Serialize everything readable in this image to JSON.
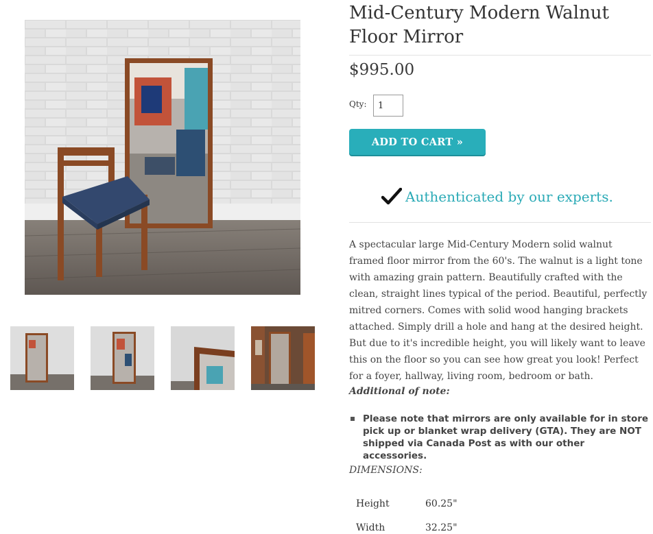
{
  "product": {
    "title": "Mid-Century Modern Walnut Floor Mirror",
    "price": "$995.00",
    "qty_label": "Qty:",
    "qty_value": "1",
    "add_to_cart": "ADD TO CART »",
    "authenticated": "Authenticated by our experts."
  },
  "description": "A spectacular large Mid-Century Modern solid walnut framed floor mirror from the 60's. The walnut is a light tone with amazing grain pattern. Beautifully crafted with the clean, straight lines typical of the period. Beautiful, perfectly mitred corners. Comes with solid wood hanging brackets attached. Simply drill a hole and hang at the desired height. But due to it's incredible height, you will likely want to leave this on the floor so you can see how great you look! Perfect for a foyer, hallway, living room, bedroom or bath.",
  "additional": {
    "heading": "Additional of note:",
    "items": [
      "Please note that mirrors are only available for in store pick up or blanket wrap delivery (GTA). They are NOT shipped via Canada Post as with our other accessories."
    ]
  },
  "dimensions": {
    "heading": "DIMENSIONS:",
    "rows": [
      {
        "label": "Height",
        "value": "60.25\""
      },
      {
        "label": "Width",
        "value": "32.25\""
      }
    ]
  },
  "colors": {
    "accent": "#29aeba",
    "auth_text": "#2aaab6",
    "walnut": "#8a4a25",
    "brick_wall": "#dcdcdc",
    "floor": "#6f6862"
  },
  "icons": {
    "check": "check-icon"
  }
}
